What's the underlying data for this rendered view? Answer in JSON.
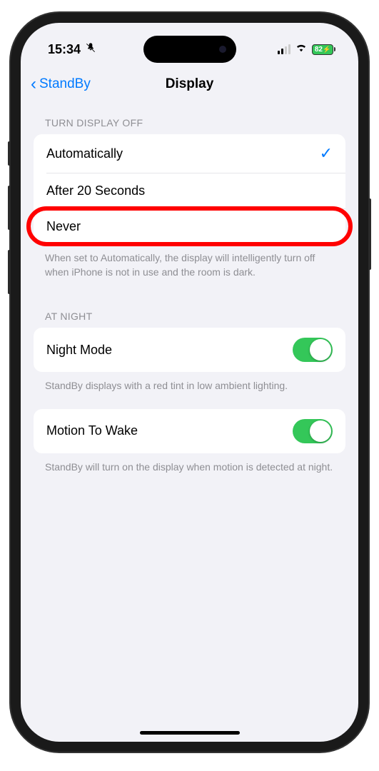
{
  "status": {
    "time": "15:34",
    "battery_pct": "82"
  },
  "nav": {
    "back_label": "StandBy",
    "title": "Display"
  },
  "sections": {
    "turn_off": {
      "header": "TURN DISPLAY OFF",
      "options": {
        "auto": "Automatically",
        "after20": "After 20 Seconds",
        "never": "Never"
      },
      "footer": "When set to Automatically, the display will intelligently turn off when iPhone is not in use and the room is dark."
    },
    "at_night": {
      "header": "AT NIGHT",
      "night_mode_label": "Night Mode",
      "footer": "StandBy displays with a red tint in low ambient lighting."
    },
    "motion": {
      "label": "Motion To Wake",
      "footer": "StandBy will turn on the display when motion is detected at night."
    }
  }
}
